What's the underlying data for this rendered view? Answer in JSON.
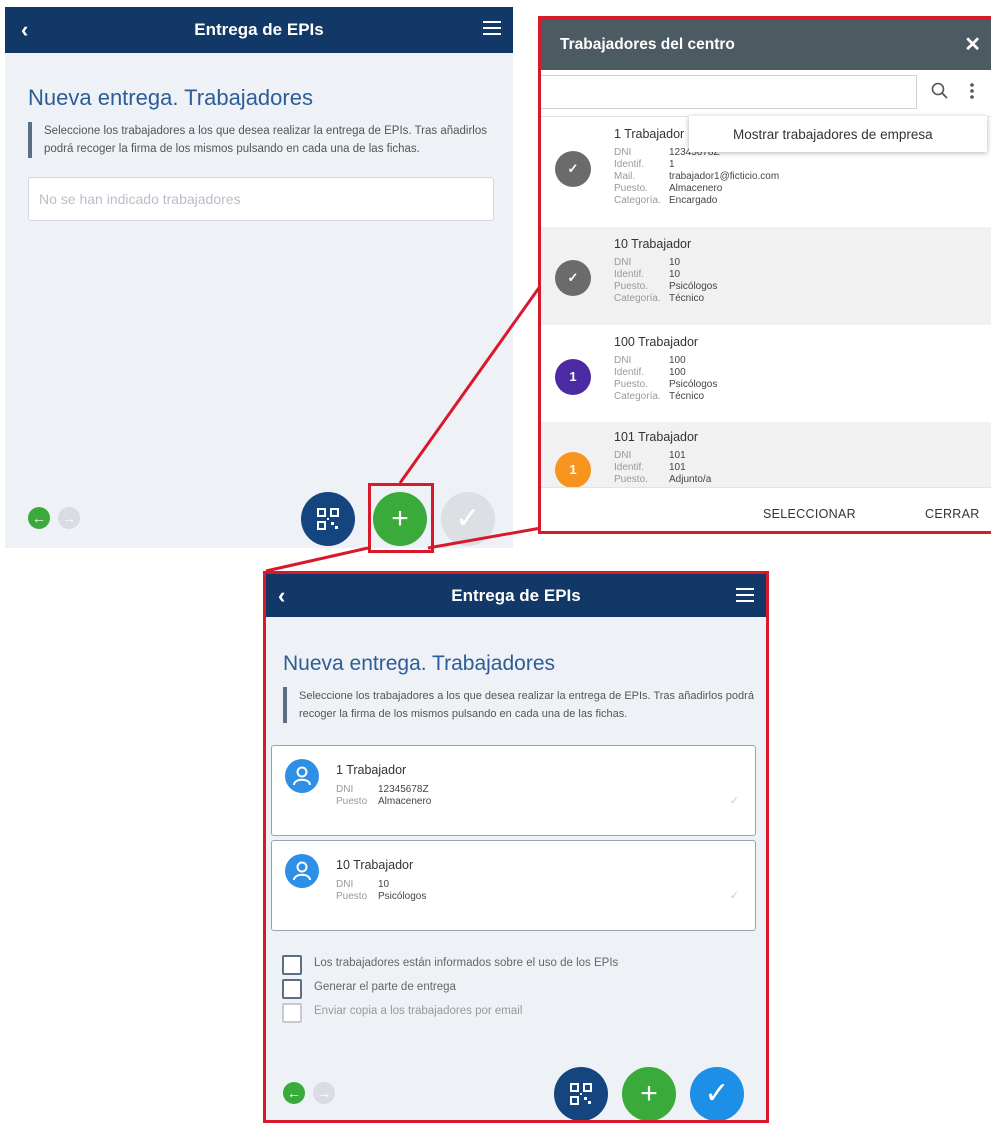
{
  "colors": {
    "header_bg": "#123867",
    "accent_red": "#d8192b",
    "green": "#3aaa3a",
    "blue_action": "#1e8fe6",
    "dark_blue_fab": "#14457f",
    "dialog_header": "#4c5a62",
    "heading_blue": "#2c5d97"
  },
  "screen_before": {
    "header": {
      "back_icon": "chevron-left-icon",
      "title": "Entrega de EPIs",
      "menu_icon": "hamburger-menu-icon"
    },
    "heading": "Nueva entrega. Trabajadores",
    "instructions": "Seleccione los trabajadores a los que desea realizar la entrega de EPIs. Tras añadirlos podrá recoger la firma de los mismos pulsando en cada una de las fichas.",
    "workers_placeholder": "No se han indicado trabajadores",
    "nav_back_icon": "arrow-left-icon",
    "nav_forward_icon": "arrow-right-icon",
    "actions": {
      "qr": "qr-scan-icon",
      "add": "+",
      "confirm": "✓"
    }
  },
  "dialog": {
    "title": "Trabajadores del centro",
    "close": "✕",
    "search_value": "",
    "search_icon": "search-icon",
    "more_icon": "more-vert-icon",
    "dropdown_option": "Mostrar trabajadores de empresa",
    "workers": [
      {
        "name": "1 Trabajador",
        "badge": "✓",
        "fields": [
          {
            "k": "DNI",
            "v": "12345678Z"
          },
          {
            "k": "Identif.",
            "v": "1"
          },
          {
            "k": "Mail.",
            "v": "trabajador1@ficticio.com"
          },
          {
            "k": "Puesto.",
            "v": "Almacenero"
          },
          {
            "k": "Categoría.",
            "v": "Encargado"
          }
        ]
      },
      {
        "name": "10 Trabajador",
        "badge": "✓",
        "fields": [
          {
            "k": "DNI",
            "v": "10"
          },
          {
            "k": "Identif.",
            "v": "10"
          },
          {
            "k": "Puesto.",
            "v": "Psicólogos"
          },
          {
            "k": "Categoría.",
            "v": "Técnico"
          }
        ]
      },
      {
        "name": "100 Trabajador",
        "badge": "1",
        "fields": [
          {
            "k": "DNI",
            "v": "100"
          },
          {
            "k": "Identif.",
            "v": "100"
          },
          {
            "k": "Puesto.",
            "v": "Psicólogos"
          },
          {
            "k": "Categoría.",
            "v": "Técnico"
          }
        ]
      },
      {
        "name": "101 Trabajador",
        "badge": "1",
        "fields": [
          {
            "k": "DNI",
            "v": "101"
          },
          {
            "k": "Identif.",
            "v": "101"
          },
          {
            "k": "Puesto.",
            "v": "Adjunto/a"
          }
        ]
      }
    ],
    "select_button": "SELECCIONAR",
    "close_button": "CERRAR"
  },
  "screen_after": {
    "header": {
      "title": "Entrega de EPIs"
    },
    "heading": "Nueva entrega. Trabajadores",
    "instructions": "Seleccione los trabajadores a los que desea realizar la entrega de EPIs. Tras añadirlos podrá recoger la firma de los mismos pulsando en cada una de las fichas.",
    "cards": [
      {
        "name": "1 Trabajador",
        "dni_label": "DNI",
        "dni": "12345678Z",
        "puesto_label": "Puesto",
        "puesto": "Almacenero"
      },
      {
        "name": "10 Trabajador",
        "dni_label": "DNI",
        "dni": "10",
        "puesto_label": "Puesto",
        "puesto": "Psicólogos"
      }
    ],
    "checkboxes": [
      {
        "label": "Los trabajadores están informados sobre el uso de los EPIs",
        "checked": false,
        "disabled": false
      },
      {
        "label": "Generar el parte de entrega",
        "checked": false,
        "disabled": false
      },
      {
        "label": "Enviar copia a los trabajadores por email",
        "checked": false,
        "disabled": true
      }
    ]
  }
}
